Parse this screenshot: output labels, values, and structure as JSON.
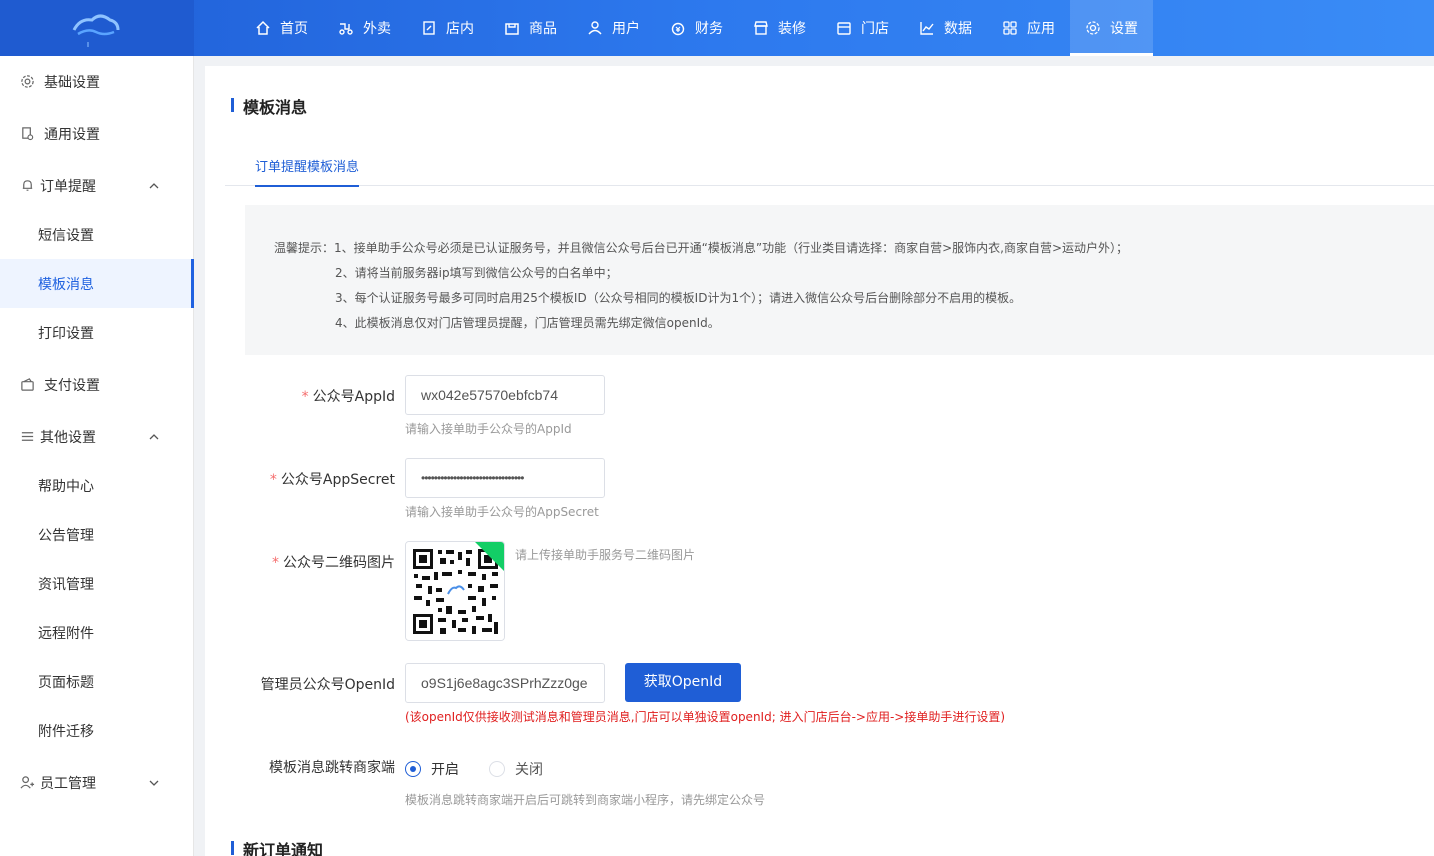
{
  "nav": {
    "items": [
      {
        "label": "首页",
        "icon": "home-icon"
      },
      {
        "label": "外卖",
        "icon": "scooter-icon"
      },
      {
        "label": "店内",
        "icon": "edit-doc-icon"
      },
      {
        "label": "商品",
        "icon": "bag-icon"
      },
      {
        "label": "用户",
        "icon": "user-icon"
      },
      {
        "label": "财务",
        "icon": "money-icon"
      },
      {
        "label": "装修",
        "icon": "shop-icon"
      },
      {
        "label": "门店",
        "icon": "store-icon"
      },
      {
        "label": "数据",
        "icon": "chart-icon"
      },
      {
        "label": "应用",
        "icon": "apps-icon"
      },
      {
        "label": "设置",
        "icon": "gear-icon"
      }
    ],
    "active": "设置"
  },
  "sidebar": {
    "items": [
      {
        "label": "基础设置",
        "icon": "gear-icon"
      },
      {
        "label": "通用设置",
        "icon": "doc-icon"
      },
      {
        "label": "订单提醒",
        "icon": "bell-icon"
      },
      {
        "label": "短信设置"
      },
      {
        "label": "模板消息"
      },
      {
        "label": "打印设置"
      },
      {
        "label": "支付设置",
        "icon": "wallet-icon"
      },
      {
        "label": "其他设置",
        "icon": "menu-icon"
      },
      {
        "label": "帮助中心"
      },
      {
        "label": "公告管理"
      },
      {
        "label": "资讯管理"
      },
      {
        "label": "远程附件"
      },
      {
        "label": "页面标题"
      },
      {
        "label": "附件迁移"
      },
      {
        "label": "员工管理",
        "icon": "staff-icon"
      }
    ],
    "active": "模板消息"
  },
  "main": {
    "title": "模板消息",
    "tab": "订单提醒模板消息",
    "notice": [
      "温馨提示：1、接单助手公众号必须是已认证服务号，并且微信公众号后台已开通“模板消息”功能（行业类目请选择：商家自营>服饰内衣,商家自营>运动户外）；",
      "2、请将当前服务器ip填写到微信公众号的白名单中；",
      "3、每个认证服务号最多可同时启用25个模板ID（公众号相同的模板ID计为1个）；请进入微信公众号后台删除部分不启用的模板。",
      "4、此模板消息仅对门店管理员提醒，门店管理员需先绑定微信openId。"
    ],
    "appid_label": "公众号AppId",
    "appid_value": "wx042e57570ebfcb74",
    "appid_hint": "请输入接单助手公众号的AppId",
    "secret_label": "公众号AppSecret",
    "secret_value": "••••••••••••••••••••••••••••••••",
    "secret_hint": "请输入接单助手公众号的AppSecret",
    "qr_label": "公众号二维码图片",
    "qr_hint": "请上传接单助手服务号二维码图片",
    "openid_label": "管理员公众号OpenId",
    "openid_value": "o9S1j6e8agc3SPrhZzz0ge",
    "openid_button": "获取OpenId",
    "openid_hint": "(该openId仅供接收测试消息和管理员消息,门店可以单独设置openId; 进入门店后台->应用->接单助手进行设置)",
    "jump_label": "模板消息跳转商家端",
    "radio_on": "开启",
    "radio_off": "关闭",
    "jump_hint": "模板消息跳转商家端开启后可跳转到商家端小程序，请先绑定公众号",
    "next_title": "新订单通知"
  },
  "colors": {
    "primary": "#1f5ed6",
    "required": "#f56c6c",
    "warning_text": "#e02020"
  }
}
